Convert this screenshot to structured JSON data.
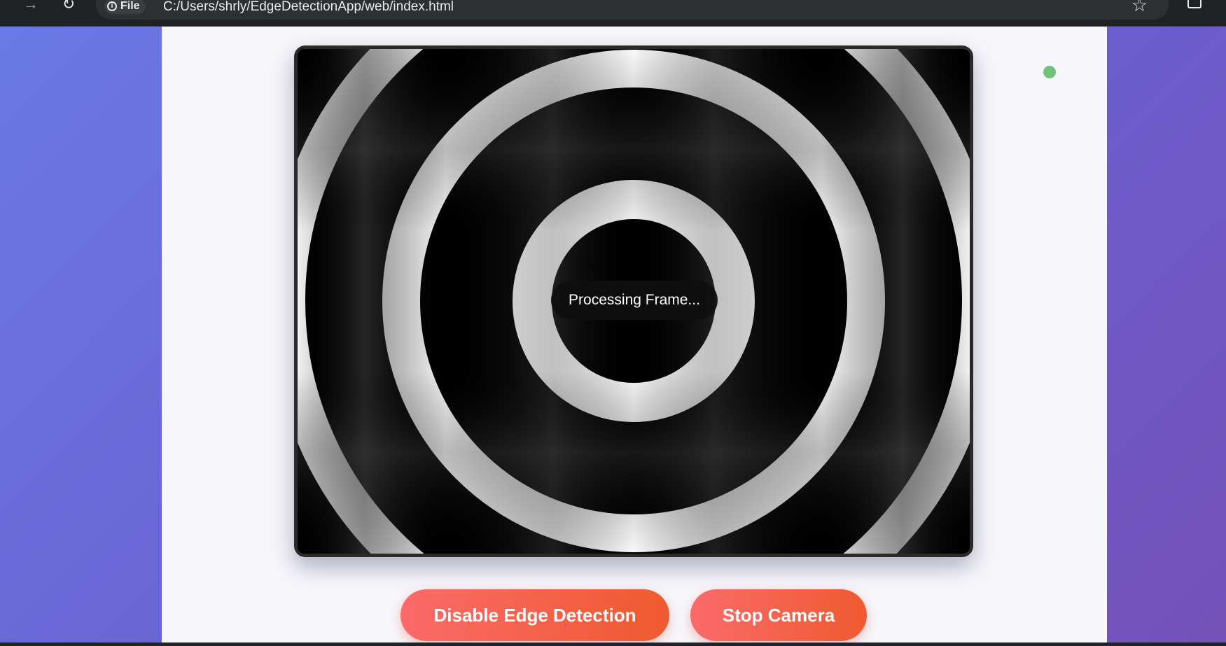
{
  "browser": {
    "site_chip_label": "File",
    "url": "C:/Users/shrly/EdgeDetectionApp/web/index.html"
  },
  "icons": [
    "forward-icon",
    "reload-icon",
    "info-icon",
    "star-icon",
    "extensions-icon"
  ],
  "viewer": {
    "overlay_text": "Processing Frame...",
    "status_color": "#73c27c"
  },
  "controls": {
    "edge_button_label": "Disable Edge Detection",
    "camera_button_label": "Stop Camera"
  },
  "colors": {
    "accent_start": "#fb6a6a",
    "accent_end": "#ef5a2f",
    "background_start": "#6a7ae6",
    "background_end": "#7452b8"
  }
}
